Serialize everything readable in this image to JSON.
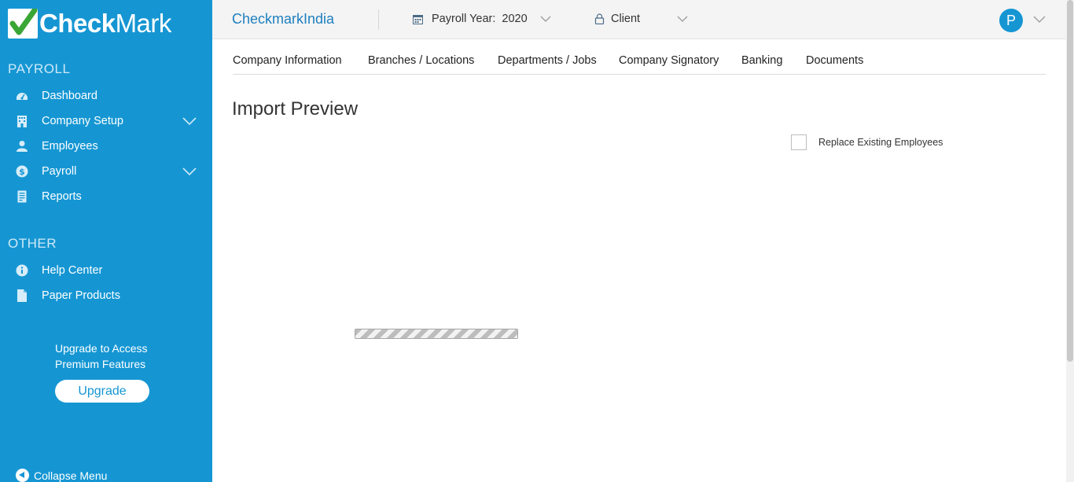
{
  "app": {
    "logo_bold": "Check",
    "logo_rest": "Mark"
  },
  "sidebar": {
    "sections": [
      {
        "title": "PAYROLL",
        "items": [
          {
            "label": "Dashboard",
            "icon": "dashboard-icon"
          },
          {
            "label": "Company Setup",
            "icon": "building-icon",
            "expandable": true
          },
          {
            "label": "Employees",
            "icon": "user-icon"
          },
          {
            "label": "Payroll",
            "icon": "dollar-icon",
            "expandable": true
          },
          {
            "label": "Reports",
            "icon": "report-icon"
          }
        ]
      },
      {
        "title": "OTHER",
        "items": [
          {
            "label": "Help Center",
            "icon": "info-icon"
          },
          {
            "label": "Paper Products",
            "icon": "document-icon"
          }
        ]
      }
    ],
    "upgrade": {
      "line1": "Upgrade to Access",
      "line2": "Premium Features",
      "button": "Upgrade"
    },
    "collapse_label": "Collapse Menu"
  },
  "topbar": {
    "brand": "CheckmarkIndia",
    "payroll_year_label": "Payroll Year:",
    "payroll_year_value": "2020",
    "client_label": "Client",
    "avatar_letter": "P"
  },
  "tabs": [
    "Company Information",
    "Branches / Locations",
    "Departments / Jobs",
    "Company Signatory",
    "Banking",
    "Documents"
  ],
  "main": {
    "title": "Import Preview",
    "replace_checkbox_label": "Replace Existing Employees",
    "replace_checked": false
  },
  "colors": {
    "sidebar": "#1596d3",
    "brand_text": "#1e7fbf",
    "logo_check": "#3aa635"
  }
}
